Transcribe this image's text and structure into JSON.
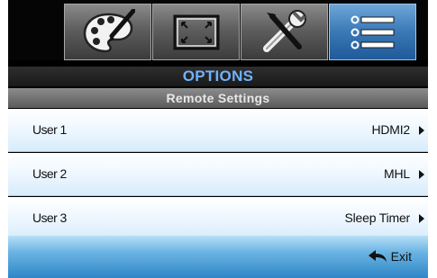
{
  "tabs": [
    {
      "icon": "palette-icon",
      "active": false
    },
    {
      "icon": "screen-resize-icon",
      "active": false
    },
    {
      "icon": "tools-icon",
      "active": false
    },
    {
      "icon": "options-list-icon",
      "active": true
    }
  ],
  "header": {
    "title": "OPTIONS",
    "subtitle": "Remote Settings"
  },
  "rows": [
    {
      "label": "User 1",
      "value": "HDMI2"
    },
    {
      "label": "User 2",
      "value": "MHL"
    },
    {
      "label": "User 3",
      "value": "Sleep Timer"
    }
  ],
  "footer": {
    "exit_label": "Exit"
  },
  "colors": {
    "accent": "#6fb2ff",
    "active_tab": "#3a78b6",
    "footer": "#2f86c5"
  }
}
